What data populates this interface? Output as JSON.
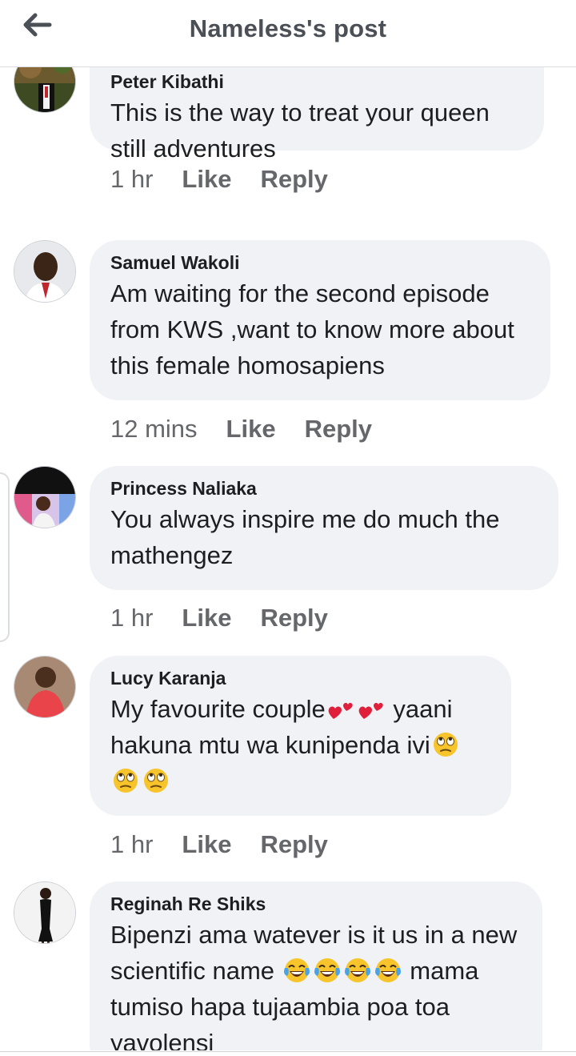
{
  "header": {
    "title": "Nameless's post",
    "back_icon": "arrow-left-icon"
  },
  "comments": [
    {
      "author": "Peter Kibathi",
      "text": "This is the way to treat your queen still adventures",
      "time": "1 hr",
      "like_label": "Like",
      "reply_label": "Reply"
    },
    {
      "author": "Samuel Wakoli",
      "text": "Am waiting for the second episode from KWS ,want to know more about this female homosapiens",
      "time": "12 mins",
      "like_label": "Like",
      "reply_label": "Reply"
    },
    {
      "author": "Princess Naliaka",
      "text": "You always inspire me do much the mathengez",
      "time": "1 hr",
      "like_label": "Like",
      "reply_label": "Reply"
    },
    {
      "author": "Lucy Karanja",
      "text_1": "My favourite couple",
      "text_2": " yaani hakuna mtu wa kunipenda ivi",
      "emoji_icons": [
        "two-hearts-emoji",
        "face-with-rolling-eyes-emoji"
      ],
      "time": "1 hr",
      "like_label": "Like",
      "reply_label": "Reply"
    },
    {
      "author": "Reginah Re Shiks",
      "text_1": "Bipenzi ama watever is it us in a new scientific name ",
      "text_2": " mama tumiso hapa tujaambia poa toa yavolensi",
      "emoji_icons": [
        "face-with-tears-of-joy-emoji"
      ]
    }
  ],
  "colors": {
    "bubble": "#f0f2f5",
    "meta_text": "#65676b",
    "title_text": "#4b4f56"
  }
}
